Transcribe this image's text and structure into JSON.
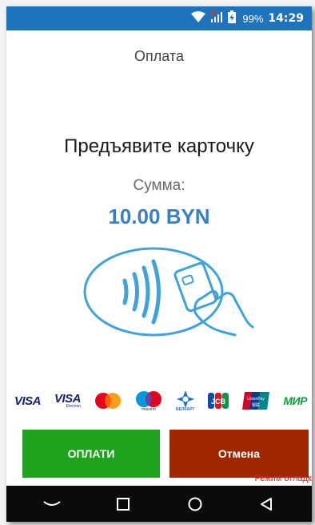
{
  "status_bar": {
    "battery_percent": "99%",
    "time": "14:29",
    "icons": [
      "wifi-icon",
      "no-sim-signal-icon",
      "battery-charging-icon"
    ]
  },
  "header": {
    "title": "Оплата"
  },
  "main": {
    "prompt": "Предъявите карточку",
    "amount_label": "Сумма:",
    "amount": "10.00 BYN",
    "illustration": "contactless-card-tap-icon",
    "accent_color": "#3a7fc2"
  },
  "payment_logos": [
    "VISA",
    "VISA Electron",
    "Mastercard",
    "Maestro",
    "БЕЛКАРТ",
    "JCB",
    "UnionPay",
    "МИР"
  ],
  "payment_logo_text": {
    "visa": "VISA",
    "visa_electron": "VISA",
    "visa_electron_sub": "Electron",
    "maestro_sub": "maestro",
    "belkart_sub": "БЕЛКАРТ",
    "jcb": "JCB",
    "unionpay": "UnionPay",
    "unionpay_sub": "银联",
    "mir": "МИР"
  },
  "actions": {
    "pay_label": "ОПЛАТИ",
    "cancel_label": "Отмена",
    "pay_color": "#1fa21d",
    "cancel_color": "#a02800"
  },
  "debug_label": "Режим отладки",
  "nav": [
    "back-chevron-icon",
    "recents-square-icon",
    "home-circle-icon",
    "back-triangle-icon"
  ]
}
